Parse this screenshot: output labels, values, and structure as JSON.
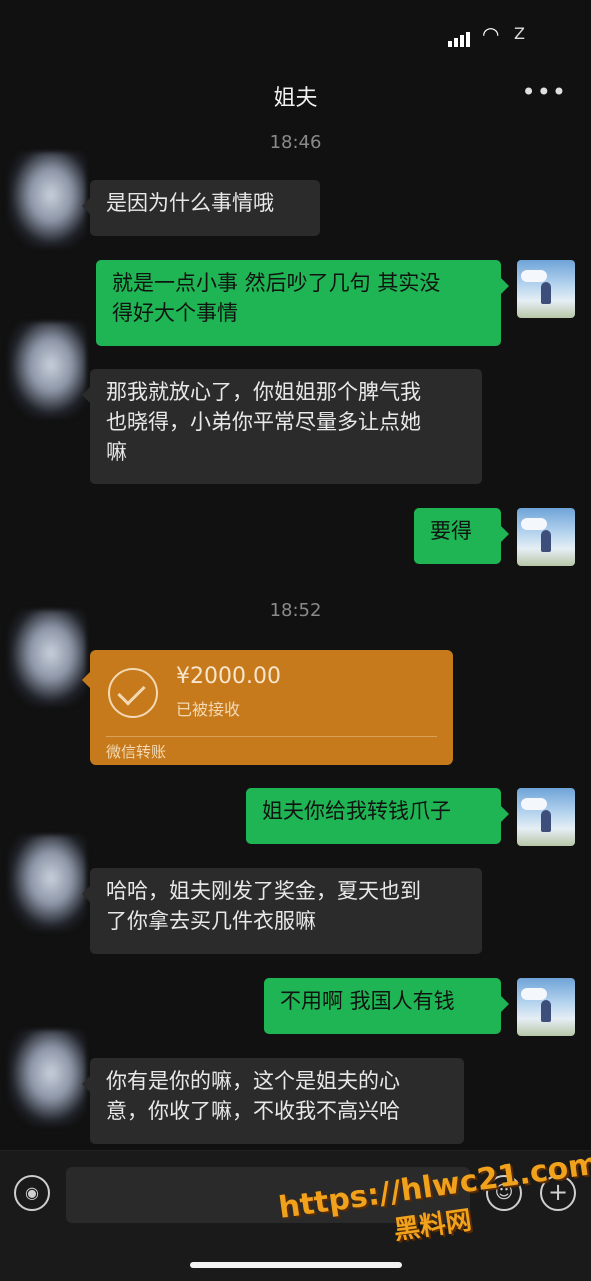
{
  "status_bar": {
    "battery": "Z "
  },
  "header": {
    "title": "姐夫",
    "more_icon": "more-dots-icon"
  },
  "messages": [
    {
      "time": "18:46"
    },
    {
      "from": "other",
      "text": "是因为什么事情哦"
    },
    {
      "from": "me",
      "lines": [
        "就是一点小事 然后吵了几句 其实没",
        "得好大个事情"
      ]
    },
    {
      "from": "other",
      "lines": [
        "那我就放心了，你姐姐那个脾气我",
        "也晓得，小弟你平常尽量多让点她",
        "嘛"
      ]
    },
    {
      "from": "me",
      "text": "要得"
    },
    {
      "time": "18:52"
    },
    {
      "from": "other",
      "type": "transfer",
      "amount": "¥2000.00",
      "status": "已被接收",
      "source": "微信转账"
    },
    {
      "from": "me",
      "text": "姐夫你给我转钱爪子"
    },
    {
      "from": "other",
      "lines": [
        "哈哈，姐夫刚发了奖金，夏天也到",
        "了你拿去买几件衣服嘛"
      ]
    },
    {
      "from": "me",
      "text": "不用啊 我国人有钱"
    },
    {
      "from": "other",
      "lines": [
        "你有是你的嘛，这个是姐夫的心",
        "意，你收了嘛，不收我不高兴哈"
      ]
    }
  ],
  "input_bar": {
    "voice_icon": "voice-icon",
    "emoji_icon": "emoji-icon",
    "plus_icon": "plus-icon"
  },
  "watermark": {
    "url": "https://hlwc21.com",
    "brand": "黑料网"
  },
  "colors": {
    "sent_bubble": "#20b554",
    "recv_bubble": "#2b2b2b",
    "transfer_card": "#c67a1c",
    "background": "#111111"
  }
}
